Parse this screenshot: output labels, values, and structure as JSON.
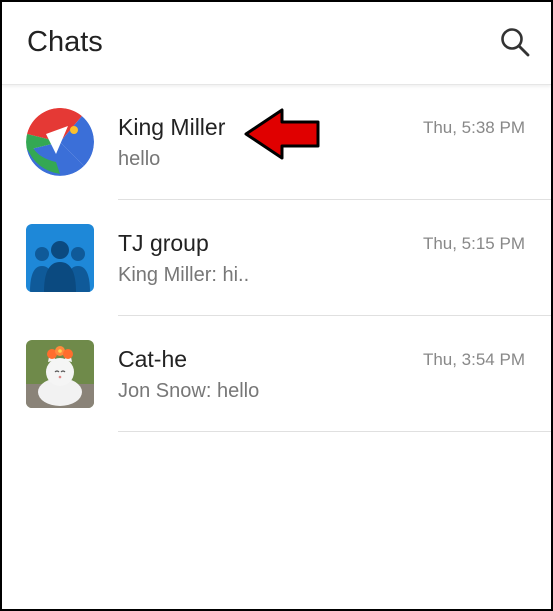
{
  "header": {
    "title": "Chats",
    "search_icon": "search-icon"
  },
  "chats": [
    {
      "name": "King Miller",
      "preview": "hello",
      "time": "Thu, 5:38 PM",
      "avatar": "multicolor-logo-avatar"
    },
    {
      "name": "TJ group",
      "preview": "King Miller: hi..",
      "time": "Thu, 5:15 PM",
      "avatar": "group-people-avatar"
    },
    {
      "name": "Cat-he",
      "preview": "Jon Snow: hello",
      "time": "Thu, 3:54 PM",
      "avatar": "cat-photo-avatar"
    }
  ],
  "annotation": {
    "icon": "red-arrow-icon",
    "color": "#e00000"
  }
}
